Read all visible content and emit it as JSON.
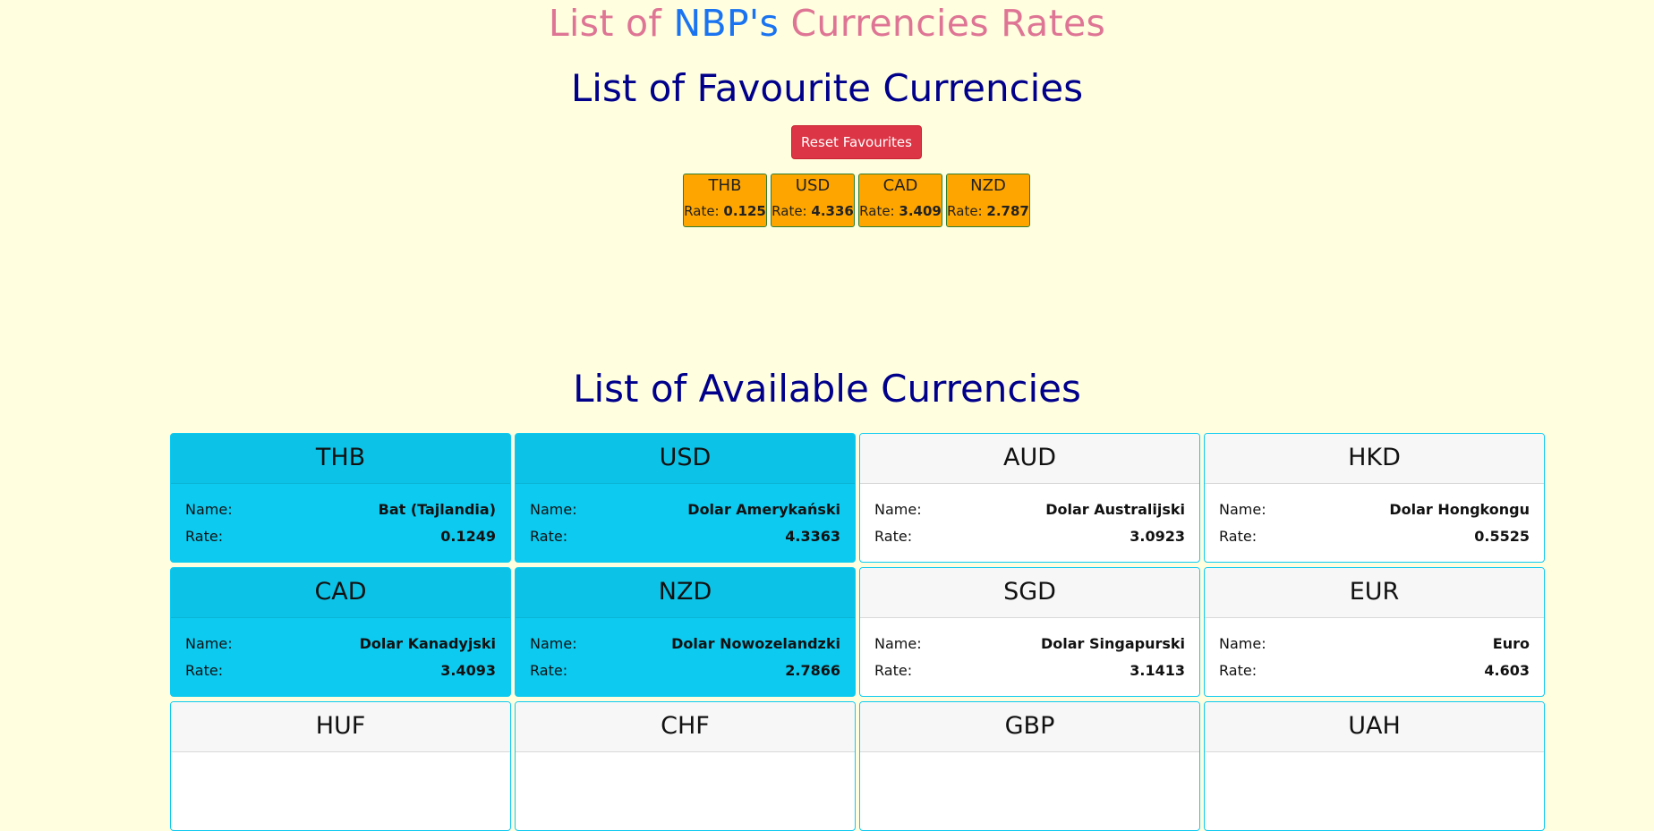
{
  "header": {
    "title_prefix": "List of ",
    "title_brand": "NBP's",
    "title_suffix": " Currencies Rates"
  },
  "favourites": {
    "title": "List of Favourite Currencies",
    "reset_label": "Reset Favourites",
    "rate_label": "Rate:",
    "items": [
      {
        "code": "THB",
        "rate": "0.125"
      },
      {
        "code": "USD",
        "rate": "4.336"
      },
      {
        "code": "CAD",
        "rate": "3.409"
      },
      {
        "code": "NZD",
        "rate": "2.787"
      }
    ]
  },
  "available": {
    "title": "List of Available Currencies",
    "name_label": "Name:",
    "rate_label": "Rate:",
    "items": [
      {
        "code": "THB",
        "name": "Bat (Tajlandia)",
        "rate": "0.1249",
        "favourite": true
      },
      {
        "code": "USD",
        "name": "Dolar Amerykański",
        "rate": "4.3363",
        "favourite": true
      },
      {
        "code": "AUD",
        "name": "Dolar Australijski",
        "rate": "3.0923",
        "favourite": false
      },
      {
        "code": "HKD",
        "name": "Dolar Hongkongu",
        "rate": "0.5525",
        "favourite": false
      },
      {
        "code": "CAD",
        "name": "Dolar Kanadyjski",
        "rate": "3.4093",
        "favourite": true
      },
      {
        "code": "NZD",
        "name": "Dolar Nowozelandzki",
        "rate": "2.7866",
        "favourite": true
      },
      {
        "code": "SGD",
        "name": "Dolar Singapurski",
        "rate": "3.1413",
        "favourite": false
      },
      {
        "code": "EUR",
        "name": "Euro",
        "rate": "4.603",
        "favourite": false
      },
      {
        "code": "HUF",
        "favourite": false
      },
      {
        "code": "CHF",
        "favourite": false
      },
      {
        "code": "GBP",
        "favourite": false
      },
      {
        "code": "UAH",
        "favourite": false
      }
    ]
  },
  "colors": {
    "favourite_card": "#0dcaf0",
    "favourite_chip": "#ffa500",
    "reset_button": "#dc3545",
    "heading": "#00008b"
  }
}
